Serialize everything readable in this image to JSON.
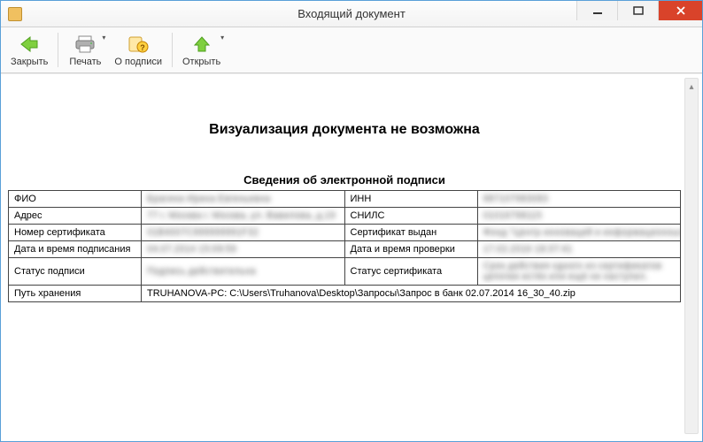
{
  "window": {
    "title": "Входящий документ"
  },
  "toolbar": {
    "close": "Закрыть",
    "print": "Печать",
    "about_sign": "О подписи",
    "open": "Открыть"
  },
  "doc": {
    "heading": "Визуализация документа не возможна",
    "subheading": "Сведения об электронной подписи",
    "labels": {
      "fio": "ФИО",
      "inn": "ИНН",
      "address": "Адрес",
      "snils": "СНИЛС",
      "cert_no": "Номер сертификата",
      "cert_issuer": "Сертификат выдан",
      "sign_time": "Дата и время подписания",
      "check_time": "Дата и время проверки",
      "sign_status": "Статус подписи",
      "cert_status": "Статус сертификата",
      "path": "Путь хранения"
    },
    "values": {
      "fio": "Брагина Ирина Евгеньевна",
      "inn": "987107983083",
      "address": "77 г. Москва г. Москва, ул. Вавилова, д.19",
      "snils": "01016798115",
      "cert_no": "01B4007C999999991F32",
      "cert_issuer": "Фонд \"Центр инноваций и информационных технологий\"",
      "sign_time": "04.07.2014 15:09:59",
      "check_time": "17.02.2016 18:37:41",
      "sign_status": "Подпись действительна",
      "cert_status": "Срок действия одного из сертификатов цепочки истёк или ещё не наступил.",
      "path": "TRUHANOVA-PC: C:\\Users\\Truhanova\\Desktop\\Запросы\\Запрос в банк 02.07.2014 16_30_40.zip"
    }
  }
}
